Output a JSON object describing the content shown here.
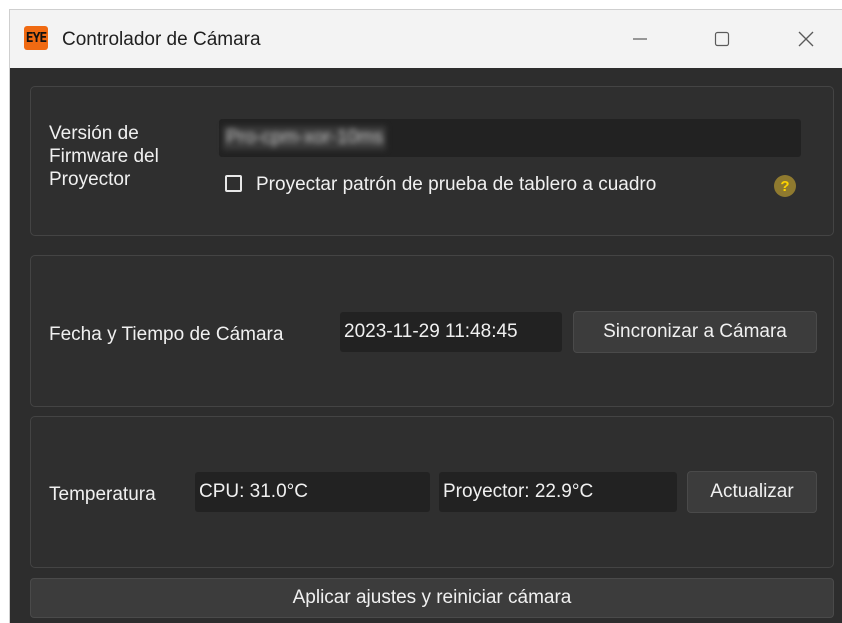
{
  "window": {
    "title": "Controlador de Cámara",
    "app_icon_text": "EYE",
    "minimize_icon": "minimize-icon",
    "maximize_icon": "maximize-icon",
    "close_icon": "close-icon"
  },
  "firmware": {
    "label": "Versión de Firmware del Proyector",
    "value": "Pro-cpm-xor-10ms",
    "checkerboard_label": "Proyectar patrón de prueba de tablero a cuadro",
    "checkerboard_checked": false,
    "help_icon": "question-icon",
    "help_glyph": "?"
  },
  "datetime": {
    "label": "Fecha y Tiempo de Cámara",
    "value": "2023-11-29 11:48:45",
    "sync_button": "Sincronizar a Cámara"
  },
  "temperature": {
    "label": "Temperatura",
    "cpu_value": "CPU: 31.0°C",
    "projector_value": "Proyector: 22.9°C",
    "refresh_button": "Actualizar"
  },
  "apply_button": "Aplicar ajustes y reiniciar cámara"
}
